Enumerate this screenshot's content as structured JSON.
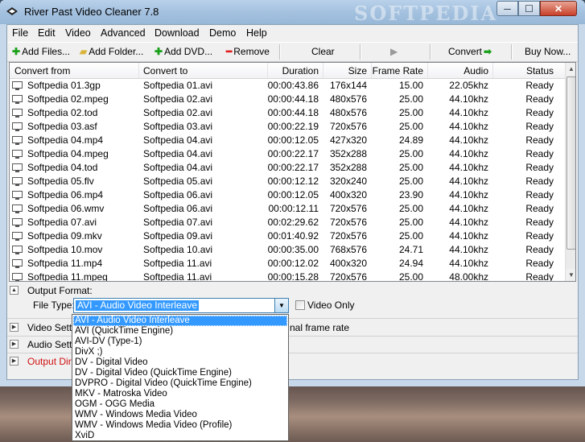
{
  "window": {
    "title": "River Past Video Cleaner 7.8",
    "watermark": "SOFTPEDIA",
    "controls": {
      "minimize": "─",
      "maximize": "☐",
      "close": "✕"
    }
  },
  "menu": [
    "File",
    "Edit",
    "Video",
    "Advanced",
    "Download",
    "Demo",
    "Help"
  ],
  "toolbar": {
    "add_files": "Add Files...",
    "add_folder": "Add Folder...",
    "add_dvd": "Add DVD...",
    "remove": "Remove",
    "clear": "Clear",
    "convert": "Convert",
    "buy_now": "Buy Now..."
  },
  "table": {
    "columns": [
      "Convert from",
      "Convert to",
      "Duration",
      "Size",
      "Frame Rate",
      "Audio",
      "Status"
    ],
    "rows": [
      [
        "Softpedia 01.3gp",
        "Softpedia 01.avi",
        "00:00:43.86",
        "176x144",
        "15.00",
        "22.05khz",
        "Ready"
      ],
      [
        "Softpedia 02.mpeg",
        "Softpedia 02.avi",
        "00:00:44.18",
        "480x576",
        "25.00",
        "44.10khz",
        "Ready"
      ],
      [
        "Softpedia 02.tod",
        "Softpedia 02.avi",
        "00:00:44.18",
        "480x576",
        "25.00",
        "44.10khz",
        "Ready"
      ],
      [
        "Softpedia 03.asf",
        "Softpedia 03.avi",
        "00:00:22.19",
        "720x576",
        "25.00",
        "44.10khz",
        "Ready"
      ],
      [
        "Softpedia 04.mp4",
        "Softpedia 04.avi",
        "00:00:12.05",
        "427x320",
        "24.89",
        "44.10khz",
        "Ready"
      ],
      [
        "Softpedia 04.mpeg",
        "Softpedia 04.avi",
        "00:00:22.17",
        "352x288",
        "25.00",
        "44.10khz",
        "Ready"
      ],
      [
        "Softpedia 04.tod",
        "Softpedia 04.avi",
        "00:00:22.17",
        "352x288",
        "25.00",
        "44.10khz",
        "Ready"
      ],
      [
        "Softpedia 05.flv",
        "Softpedia 05.avi",
        "00:00:12.12",
        "320x240",
        "25.00",
        "44.10khz",
        "Ready"
      ],
      [
        "Softpedia 06.mp4",
        "Softpedia 06.avi",
        "00:00:12.05",
        "400x320",
        "23.90",
        "44.10khz",
        "Ready"
      ],
      [
        "Softpedia 06.wmv",
        "Softpedia 06.avi",
        "00:00:12.11",
        "720x576",
        "25.00",
        "44.10khz",
        "Ready"
      ],
      [
        "Softpedia 07.avi",
        "Softpedia 07.avi",
        "00:02:29.62",
        "720x576",
        "25.00",
        "44.10khz",
        "Ready"
      ],
      [
        "Softpedia 09.mkv",
        "Softpedia 09.avi",
        "00:01:40.92",
        "720x576",
        "25.00",
        "44.10khz",
        "Ready"
      ],
      [
        "Softpedia 10.mov",
        "Softpedia 10.avi",
        "00:00:35.00",
        "768x576",
        "24.71",
        "44.10khz",
        "Ready"
      ],
      [
        "Softpedia 11.mp4",
        "Softpedia 11.avi",
        "00:00:12.02",
        "400x320",
        "24.94",
        "44.10khz",
        "Ready"
      ],
      [
        "Softpedia 11.mpeg",
        "Softpedia 11.avi",
        "00:00:15.28",
        "720x576",
        "25.00",
        "48.00khz",
        "Ready"
      ]
    ]
  },
  "panels": {
    "output_format": "Output Format:",
    "file_type_label": "File Type:",
    "file_type_value": "AVI - Audio Video Interleave",
    "video_only": "Video Only",
    "video_settings": "Video Setti",
    "video_settings_overflow": "nal frame rate",
    "audio_settings": "Audio Setti",
    "output_dir": "Output Dire"
  },
  "dropdown_options": [
    "AVI - Audio Video Interleave",
    "AVI (QuickTime Engine)",
    "AVI-DV (Type-1)",
    "DivX ;)",
    "DV - Digital Video",
    "DV - Digital Video (QuickTime Engine)",
    "DVPRO - Digital Video (QuickTime Engine)",
    "MKV - Matroska Video",
    "OGM - OGG Media",
    "WMV - Windows Media Video",
    "WMV - Windows Media Video (Profile)",
    "XviD"
  ],
  "colors": {
    "selection": "#3399ff",
    "add_green": "#1aa01a",
    "remove_red": "#e01818",
    "output_dir_red": "#d01010"
  }
}
